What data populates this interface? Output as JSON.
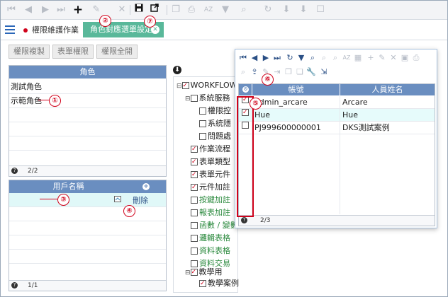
{
  "toolbar": {
    "icons": [
      "first-page-icon",
      "prev-icon",
      "next-icon",
      "last-page-icon",
      "add-icon",
      "edit-icon",
      "delete-icon",
      "save-icon",
      "export-icon",
      "copy-icon",
      "print-icon",
      "sort-icon",
      "filter-icon",
      "search-icon",
      "refresh-icon",
      "import-icon",
      "download-icon",
      "clipboard-icon"
    ]
  },
  "tabs": {
    "tab1_label": "權限維護作業",
    "tab2_label": "角色對應選單設定"
  },
  "permission_buttons": [
    "權限複製",
    "表單權限",
    "權限全開"
  ],
  "role_grid": {
    "header": "角色",
    "rows": [
      "測試角色",
      "示範角色"
    ],
    "footer": "2/2"
  },
  "user_grid": {
    "header": "用戶名稱",
    "delete_label": "刪除",
    "footer": "1/1"
  },
  "tree": {
    "root": "WORKFLOW",
    "items": [
      {
        "label": "系統服務",
        "level": 1,
        "checked": false,
        "green": false
      },
      {
        "label": "權限控",
        "level": 2,
        "checked": false,
        "green": false
      },
      {
        "label": "系統隱",
        "level": 2,
        "checked": false,
        "green": false
      },
      {
        "label": "問題處",
        "level": 2,
        "checked": false,
        "green": false
      },
      {
        "label": "作業流程",
        "level": 1,
        "checked": true,
        "green": false
      },
      {
        "label": "表單類型",
        "level": 1,
        "checked": true,
        "green": false
      },
      {
        "label": "表單元件",
        "level": 1,
        "checked": true,
        "green": false
      },
      {
        "label": "元件加註",
        "level": 1,
        "checked": true,
        "green": false
      },
      {
        "label": "按鍵加註",
        "level": 1,
        "checked": false,
        "green": true
      },
      {
        "label": "報表加註",
        "level": 1,
        "checked": false,
        "green": true
      },
      {
        "label": "函數 / 變數",
        "level": 1,
        "checked": false,
        "green": true
      },
      {
        "label": "邏輯表格",
        "level": 1,
        "checked": false,
        "green": true
      },
      {
        "label": "資料表格",
        "level": 1,
        "checked": false,
        "green": true
      },
      {
        "label": "資料交易",
        "level": 1,
        "checked": false,
        "green": true
      },
      {
        "label": "教學用",
        "level": 1,
        "checked": true,
        "green": false
      },
      {
        "label": "教學案例",
        "level": 2,
        "checked": true,
        "green": false
      }
    ]
  },
  "dialog": {
    "col_account": "帳號",
    "col_name": "人員姓名",
    "rows": [
      {
        "account": "admin_arcare",
        "name": "Arcare",
        "checked": true
      },
      {
        "account": "Hue",
        "name": "Hue",
        "checked": true
      },
      {
        "account": "PJ999600000001",
        "name": "DKS測試案例",
        "checked": false
      }
    ],
    "footer": "2/3"
  },
  "callouts": [
    "①",
    "②",
    "③",
    "④",
    "⑤",
    "⑥",
    "⑦"
  ],
  "colors": {
    "accent_tab": "#59b89a",
    "grid_header": "#6a8ec0",
    "callout": "#d0021b"
  }
}
